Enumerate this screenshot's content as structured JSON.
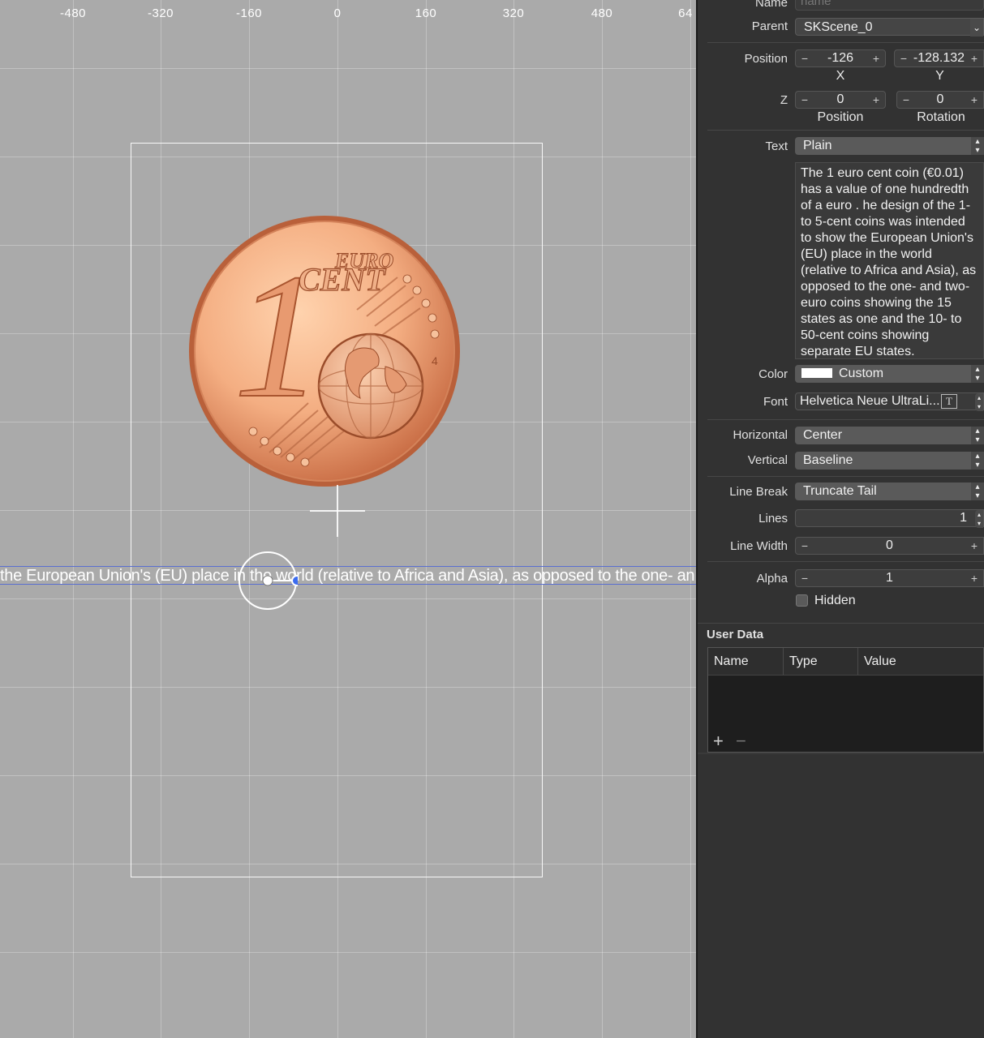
{
  "canvas": {
    "ruler_labels": [
      "-480",
      "-320",
      "-160",
      "0",
      "160",
      "320",
      "480",
      "64"
    ],
    "label_text": "the European Union's (EU) place in the world (relative to Africa and Asia), as opposed to the one- an",
    "coin_image": {
      "top_text": "EURO",
      "middle_text": "CENT",
      "numeral": "1",
      "small_numeral": "4"
    }
  },
  "inspector": {
    "name": {
      "label": "Name",
      "placeholder": "name"
    },
    "parent": {
      "label": "Parent",
      "value": "SKScene_0"
    },
    "position": {
      "label": "Position",
      "x": "-126",
      "y": "-128.132",
      "x_caption": "X",
      "y_caption": "Y"
    },
    "z": {
      "label": "Z",
      "z_value": "0",
      "rotation_value": "0",
      "position_caption": "Position",
      "rotation_caption": "Rotation"
    },
    "text": {
      "label": "Text",
      "type": "Plain",
      "content": "The 1 euro cent coin (€0.01) has a value of one hundredth of a euro . he design of the 1- to 5-cent coins was intended to show the European Union's (EU) place in the world (relative to Africa and Asia), as opposed to the one- and two-euro coins showing the 15 states as one and the 10- to 50-cent coins showing separate EU states."
    },
    "color": {
      "label": "Color",
      "value": "Custom",
      "swatch": "#ffffff"
    },
    "font": {
      "label": "Font",
      "value": "Helvetica Neue UltraLi..."
    },
    "horizontal": {
      "label": "Horizontal",
      "value": "Center"
    },
    "vertical": {
      "label": "Vertical",
      "value": "Baseline"
    },
    "line_break": {
      "label": "Line Break",
      "value": "Truncate Tail"
    },
    "lines": {
      "label": "Lines",
      "value": "1"
    },
    "line_width": {
      "label": "Line Width",
      "value": "0"
    },
    "alpha": {
      "label": "Alpha",
      "value": "1"
    },
    "hidden": {
      "label": "Hidden",
      "checked": false
    },
    "user_data": {
      "title": "User Data",
      "columns": [
        "Name",
        "Type",
        "Value"
      ],
      "add_label": "+",
      "remove_label": "−"
    }
  },
  "colors": {
    "canvas_bg": "#aaaaaa",
    "panel_bg": "#323232",
    "selection": "#5a6fd0",
    "handle_blue": "#3b6cf0"
  }
}
